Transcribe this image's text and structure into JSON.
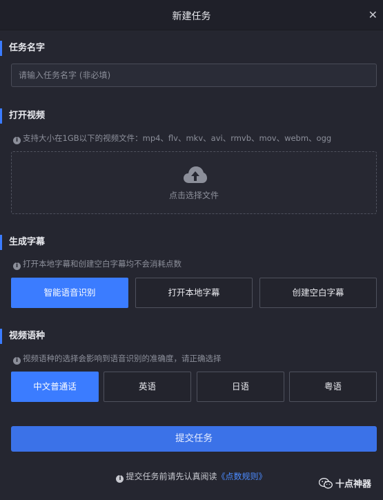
{
  "dialog": {
    "title": "新建任务",
    "close_label": "✕"
  },
  "task_name": {
    "heading": "任务名字",
    "placeholder": "请输入任务名字 (非必填)"
  },
  "open_video": {
    "heading": "打开视频",
    "hint": "支持大小在1GB以下的视频文件：mp4、flv、mkv、avi、rmvb、mov、webm、ogg",
    "upload_label": "点击选择文件",
    "upload_icon": "cloud-upload-icon"
  },
  "subtitle": {
    "heading": "生成字幕",
    "hint": "打开本地字幕和创建空白字幕均不会消耗点数",
    "options": [
      "智能语音识别",
      "打开本地字幕",
      "创建空白字幕"
    ],
    "selected": "智能语音识别"
  },
  "language": {
    "heading": "视频语种",
    "hint": "视频语种的选择会影响到语音识别的准确度，请正确选择",
    "options": [
      "中文普通话",
      "英语",
      "日语",
      "粤语"
    ],
    "selected": "中文普通话"
  },
  "submit_label": "提交任务",
  "footer": {
    "note": "提交任务前请先认真阅读",
    "link": "《点数规则》"
  },
  "watermark": {
    "text": "十点神器",
    "icon": "wechat-icon"
  },
  "colors": {
    "accent": "#3b7cff",
    "background": "#252630",
    "link": "#4b8bff"
  }
}
